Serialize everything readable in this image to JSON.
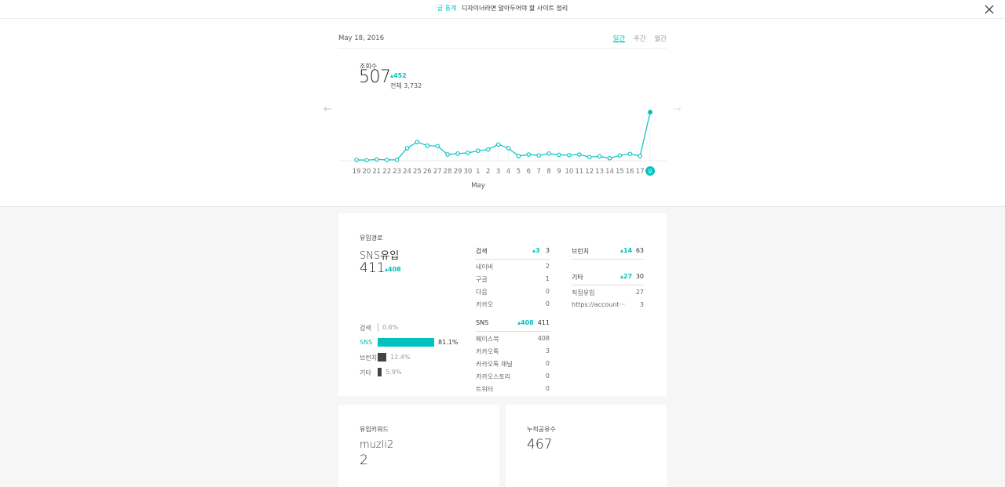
{
  "header": {
    "category": "글 통계",
    "title": "디자이너라면 알아두어야 할 사이트 정리",
    "close_icon": "close-icon"
  },
  "stats": {
    "date": "May 18, 2016",
    "periods": [
      "일간",
      "주간",
      "월간"
    ],
    "active_period": "일간",
    "views_label": "조회수",
    "views": "507",
    "views_delta": "452",
    "views_total": "전체 3,732",
    "prev_icon": "arrow-left-icon",
    "next_icon": "arrow-right-icon"
  },
  "chart_data": {
    "type": "line",
    "x": [
      "19",
      "20",
      "21",
      "22",
      "23",
      "24",
      "25",
      "26",
      "27",
      "28",
      "29",
      "30",
      "1",
      "2",
      "3",
      "4",
      "5",
      "6",
      "7",
      "8",
      "9",
      "10",
      "11",
      "12",
      "13",
      "14",
      "15",
      "16",
      "17",
      "오"
    ],
    "values": [
      3,
      2,
      4,
      3,
      3,
      40,
      60,
      48,
      47,
      20,
      23,
      25,
      32,
      36,
      52,
      40,
      15,
      20,
      17,
      23,
      19,
      18,
      20,
      12,
      14,
      8,
      17,
      22,
      15,
      507
    ],
    "xlabel": "May",
    "ylim": [
      0,
      507
    ],
    "accent": "#00c3bd",
    "grid": true
  },
  "referrals": {
    "title": "유입경로",
    "top_label": "SNS유입",
    "top_value": "411",
    "top_delta": "408",
    "bars": [
      {
        "label": "검색",
        "pct": "0.6%",
        "share": 0.006
      },
      {
        "label": "SNS",
        "pct": "81.1%",
        "share": 0.811
      },
      {
        "label": "브런치",
        "pct": "12.4%",
        "share": 0.124
      },
      {
        "label": "기타",
        "pct": "5.9%",
        "share": 0.059
      }
    ],
    "search": {
      "label": "검색",
      "delta": "3",
      "value": "3",
      "items": [
        {
          "name": "네이버",
          "value": "2"
        },
        {
          "name": "구글",
          "value": "1"
        },
        {
          "name": "다음",
          "value": "0"
        },
        {
          "name": "카카오",
          "value": "0"
        }
      ]
    },
    "sns": {
      "label": "SNS",
      "delta": "408",
      "value": "411",
      "items": [
        {
          "name": "페이스북",
          "value": "408"
        },
        {
          "name": "카카오톡",
          "value": "3"
        },
        {
          "name": "카카오톡 채널",
          "value": "0"
        },
        {
          "name": "카카오스토리",
          "value": "0"
        },
        {
          "name": "트위터",
          "value": "0"
        }
      ]
    },
    "brunch": {
      "label": "브런치",
      "delta": "14",
      "value": "63"
    },
    "etc": {
      "label": "기타",
      "delta": "27",
      "value": "30",
      "items": [
        {
          "name": "직접유입",
          "value": "27"
        },
        {
          "name": "https://account···",
          "value": "3"
        }
      ]
    }
  },
  "keywords": {
    "title": "유입키워드",
    "keyword": "muzli2",
    "count": "2"
  },
  "shares": {
    "title": "누적공유수",
    "value": "467"
  },
  "colors": {
    "accent": "#00c3bd",
    "dark_bar": "#444444"
  }
}
